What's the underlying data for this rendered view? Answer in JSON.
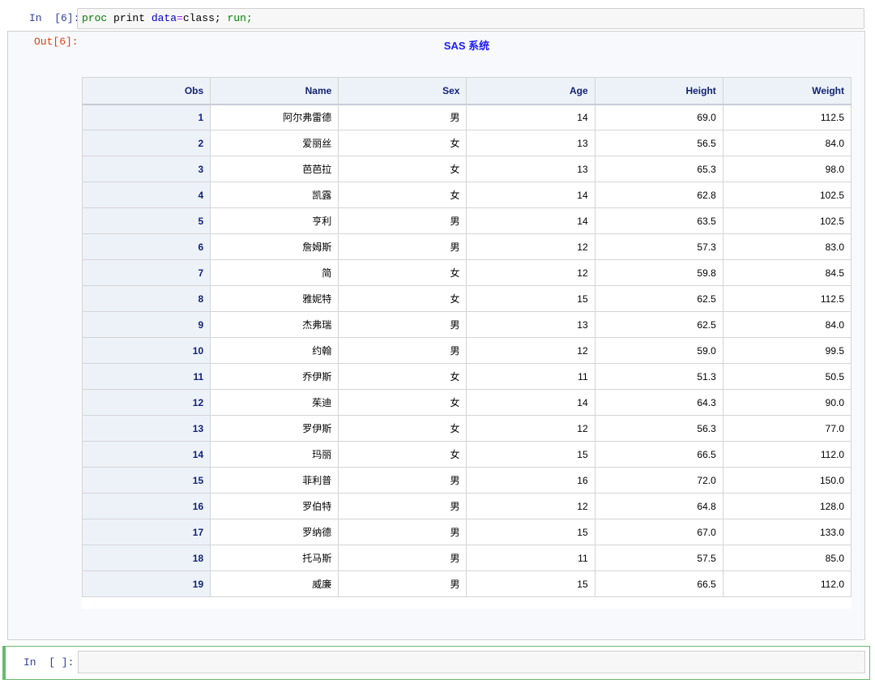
{
  "cell1": {
    "prompt": "In  [6]:",
    "code": {
      "proc": "proc",
      "print": " print ",
      "data": "data",
      "eq": "=",
      "cls": "class; ",
      "run": "run;"
    },
    "out_prompt": "Out[6]:"
  },
  "output": {
    "title": "SAS 系统",
    "columns": [
      "Obs",
      "Name",
      "Sex",
      "Age",
      "Height",
      "Weight"
    ],
    "rows": [
      [
        "1",
        "阿尔弗雷德",
        "男",
        "14",
        "69.0",
        "112.5"
      ],
      [
        "2",
        "爱丽丝",
        "女",
        "13",
        "56.5",
        "84.0"
      ],
      [
        "3",
        "芭芭拉",
        "女",
        "13",
        "65.3",
        "98.0"
      ],
      [
        "4",
        "凯露",
        "女",
        "14",
        "62.8",
        "102.5"
      ],
      [
        "5",
        "亨利",
        "男",
        "14",
        "63.5",
        "102.5"
      ],
      [
        "6",
        "詹姆斯",
        "男",
        "12",
        "57.3",
        "83.0"
      ],
      [
        "7",
        "简",
        "女",
        "12",
        "59.8",
        "84.5"
      ],
      [
        "8",
        "雅妮特",
        "女",
        "15",
        "62.5",
        "112.5"
      ],
      [
        "9",
        "杰弗瑞",
        "男",
        "13",
        "62.5",
        "84.0"
      ],
      [
        "10",
        "约翰",
        "男",
        "12",
        "59.0",
        "99.5"
      ],
      [
        "11",
        "乔伊斯",
        "女",
        "11",
        "51.3",
        "50.5"
      ],
      [
        "12",
        "茱迪",
        "女",
        "14",
        "64.3",
        "90.0"
      ],
      [
        "13",
        "罗伊斯",
        "女",
        "12",
        "56.3",
        "77.0"
      ],
      [
        "14",
        "玛丽",
        "女",
        "15",
        "66.5",
        "112.0"
      ],
      [
        "15",
        "菲利普",
        "男",
        "16",
        "72.0",
        "150.0"
      ],
      [
        "16",
        "罗伯特",
        "男",
        "12",
        "64.8",
        "128.0"
      ],
      [
        "17",
        "罗纳德",
        "男",
        "15",
        "67.0",
        "133.0"
      ],
      [
        "18",
        "托马斯",
        "男",
        "11",
        "57.5",
        "85.0"
      ],
      [
        "19",
        "威廉",
        "男",
        "15",
        "66.5",
        "112.0"
      ]
    ]
  },
  "cell2": {
    "prompt": "In  [ ]:",
    "code": ""
  }
}
